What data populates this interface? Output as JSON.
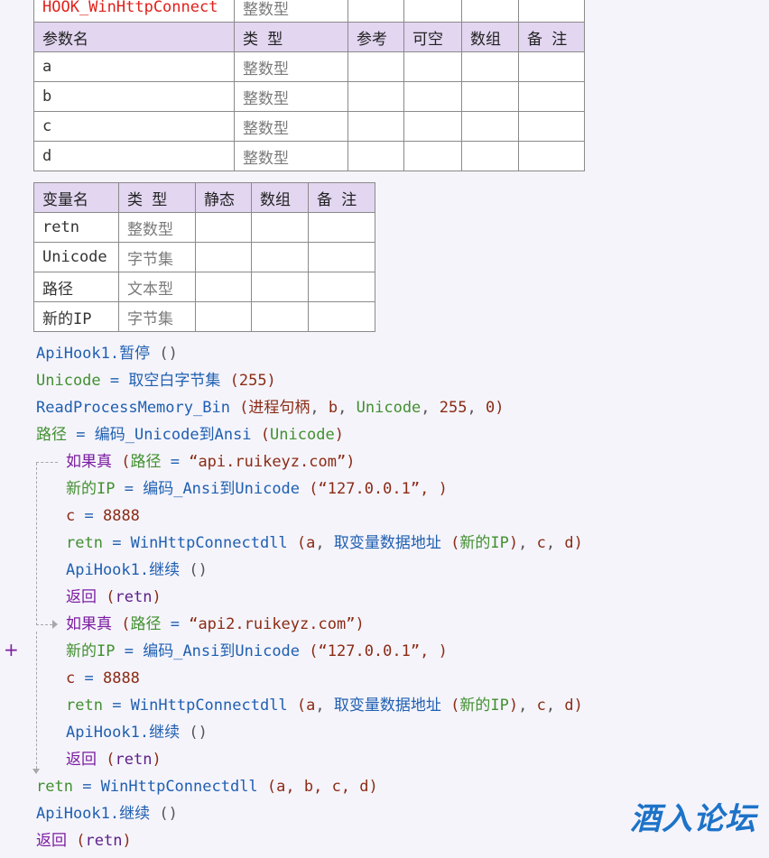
{
  "params_table": {
    "function_row": {
      "name": "HOOK_WinHttpConnect",
      "type": "整数型"
    },
    "headers": [
      "参数名",
      "类 型",
      "参考",
      "可空",
      "数组",
      "备 注"
    ],
    "rows": [
      {
        "name": "a",
        "type": "整数型"
      },
      {
        "name": "b",
        "type": "整数型"
      },
      {
        "name": "c",
        "type": "整数型"
      },
      {
        "name": "d",
        "type": "整数型"
      }
    ]
  },
  "vars_table": {
    "headers": [
      "变量名",
      "类 型",
      "静态",
      "数组",
      "备 注"
    ],
    "rows": [
      {
        "name": "retn",
        "type": "整数型"
      },
      {
        "name": "Unicode",
        "type": "字节集"
      },
      {
        "name": "路径",
        "type": "文本型"
      },
      {
        "name": "新的IP",
        "type": "字节集"
      }
    ]
  },
  "code": {
    "line1": {
      "obj": "ApiHook1",
      "method": "暂停",
      "args": " ()"
    },
    "line2": {
      "var": "Unicode",
      "op": " = ",
      "fn": "取空白字节集",
      "args": " (255)"
    },
    "line3": {
      "fn": "ReadProcessMemory_Bin",
      "open": " (",
      "a1": "进程句柄",
      "sep1": ", ",
      "a2": "b",
      "sep2": ", ",
      "a3": "Unicode",
      "sep3": ", ",
      "a4": "255",
      "sep4": ", ",
      "a5": "0",
      "close": ")"
    },
    "line4": {
      "var": "路径",
      "op": " = ",
      "fn": "编码_Unicode到Ansi",
      "open": " (",
      "a1": "Unicode",
      "close": ")"
    },
    "if1": {
      "kw": "如果真",
      "open": " (",
      "var": "路径",
      "op": " = ",
      "str": "“api.ruikeyz.com”",
      "close": ")"
    },
    "if1_body": {
      "l1": {
        "var": "新的IP",
        "op": " = ",
        "fn": "编码_Ansi到Unicode",
        "open": " (",
        "str": "“127.0.0.1”",
        "rest": ", )"
      },
      "l2": {
        "var": "c",
        "op": " = ",
        "num": "8888"
      },
      "l3": {
        "var": "retn",
        "op": " = ",
        "fn": "WinHttpConnectdll",
        "open": " (",
        "a1": "a",
        "sep1": ", ",
        "fn2": "取变量数据地址",
        "open2": " (",
        "a2": "新的IP",
        "close2": ")",
        "sep2": ", ",
        "a3": "c",
        "sep3": ", ",
        "a4": "d",
        "close": ")"
      },
      "l4": {
        "obj": "ApiHook1",
        "method": "继续",
        "args": " ()"
      },
      "l5": {
        "kw": "返回",
        "open": " (",
        "a1": "retn",
        "close": ")"
      }
    },
    "if2": {
      "kw": "如果真",
      "open": " (",
      "var": "路径",
      "op": " = ",
      "str": "“api2.ruikeyz.com”",
      "close": ")"
    },
    "if2_body": {
      "l1": {
        "var": "新的IP",
        "op": " = ",
        "fn": "编码_Ansi到Unicode",
        "open": " (",
        "str": "“127.0.0.1”",
        "rest": ", )"
      },
      "l2": {
        "var": "c",
        "op": " = ",
        "num": "8888"
      },
      "l3": {
        "var": "retn",
        "op": " = ",
        "fn": "WinHttpConnectdll",
        "open": " (",
        "a1": "a",
        "sep1": ", ",
        "fn2": "取变量数据地址",
        "open2": " (",
        "a2": "新的IP",
        "close2": ")",
        "sep2": ", ",
        "a3": "c",
        "sep3": ", ",
        "a4": "d",
        "close": ")"
      },
      "l4": {
        "obj": "ApiHook1",
        "method": "继续",
        "args": " ()"
      },
      "l5": {
        "kw": "返回",
        "open": " (",
        "a1": "retn",
        "close": ")"
      }
    },
    "line_end1": {
      "var": "retn",
      "op": " = ",
      "fn": "WinHttpConnectdll",
      "open": " (",
      "args": "a, b, c, d",
      "close": ")"
    },
    "line_end2": {
      "obj": "ApiHook1",
      "method": "继续",
      "args": " ()"
    },
    "line_end3": {
      "kw": "返回",
      "open": " (",
      "a1": "retn",
      "close": ")"
    }
  },
  "gutter": {
    "plus": "+"
  },
  "watermark": "酒入论坛",
  "colors": {
    "keyword_blue": "#1f5fb0",
    "var_green": "#41902f",
    "string_brown": "#8b2b14",
    "flow_purple": "#7b1da0",
    "header_bg": "#e2d6f0",
    "function_red": "#e0201a",
    "watermark_blue": "#1d73c8"
  }
}
